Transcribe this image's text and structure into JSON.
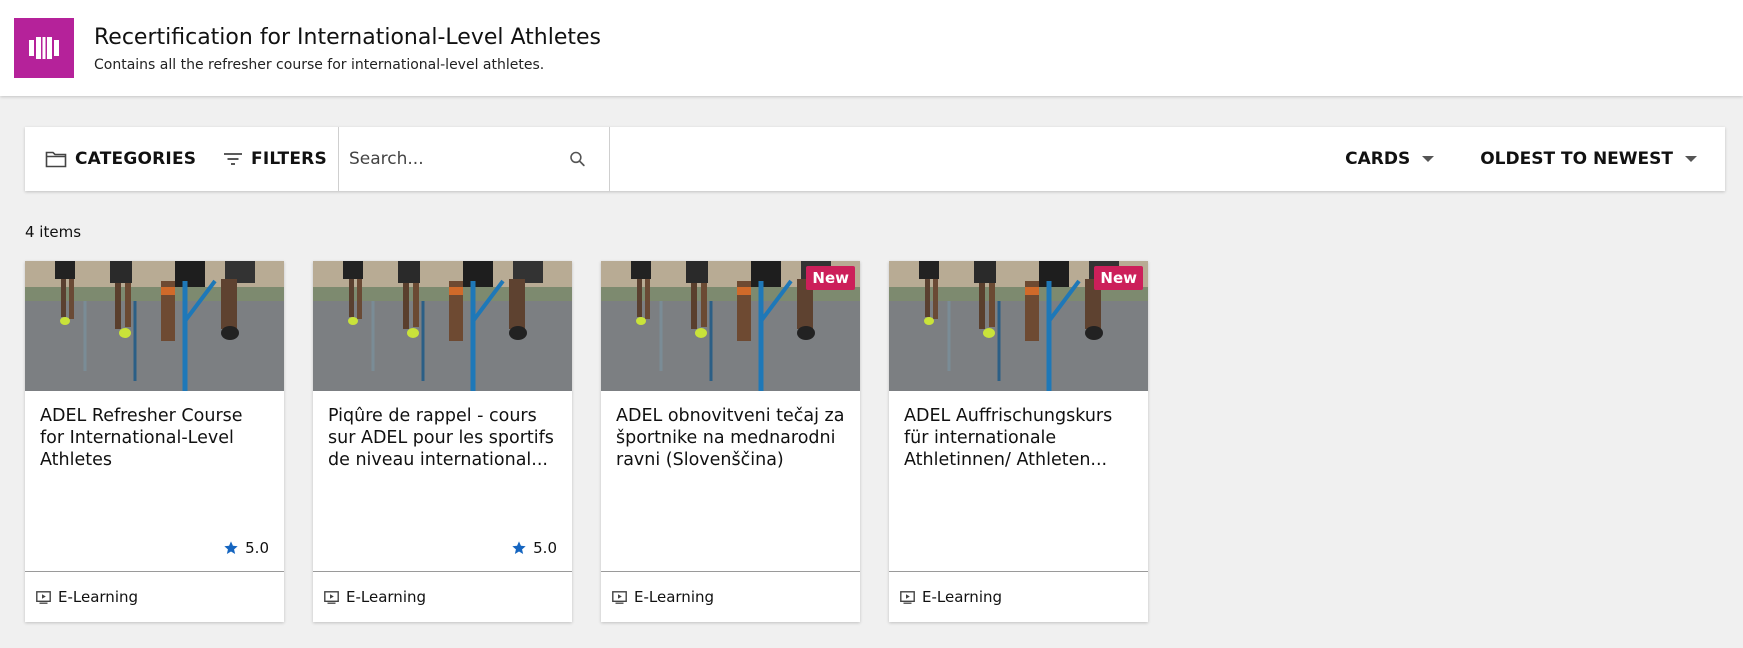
{
  "header": {
    "title": "Recertification for International-Level Athletes",
    "subtitle": "Contains all the refresher course for international-level athletes.",
    "logo_color": "#b5229a"
  },
  "toolbar": {
    "categories_label": "CATEGORIES",
    "filters_label": "FILTERS",
    "search_placeholder": "Search...",
    "view_label": "CARDS",
    "sort_label": "OLDEST TO NEWEST"
  },
  "items_count": "4 items",
  "cards": [
    {
      "title": "ADEL Refresher Course for International-Level Athletes",
      "rating": "5.0",
      "badge": "",
      "type": "E-Learning"
    },
    {
      "title": "Piqûre de rappel - cours sur ADEL pour les sportifs de niveau international...",
      "rating": "5.0",
      "badge": "",
      "type": "E-Learning"
    },
    {
      "title": "ADEL obnovitveni tečaj za športnike na mednarodni ravni (Slovenščina)",
      "rating": "",
      "badge": "New",
      "type": "E-Learning"
    },
    {
      "title": "ADEL Auffrischungskurs für internationale Athletinnen/ Athleten...",
      "rating": "",
      "badge": "New",
      "type": "E-Learning"
    }
  ],
  "colors": {
    "badge": "#cc1f5a",
    "star": "#1565c0"
  }
}
